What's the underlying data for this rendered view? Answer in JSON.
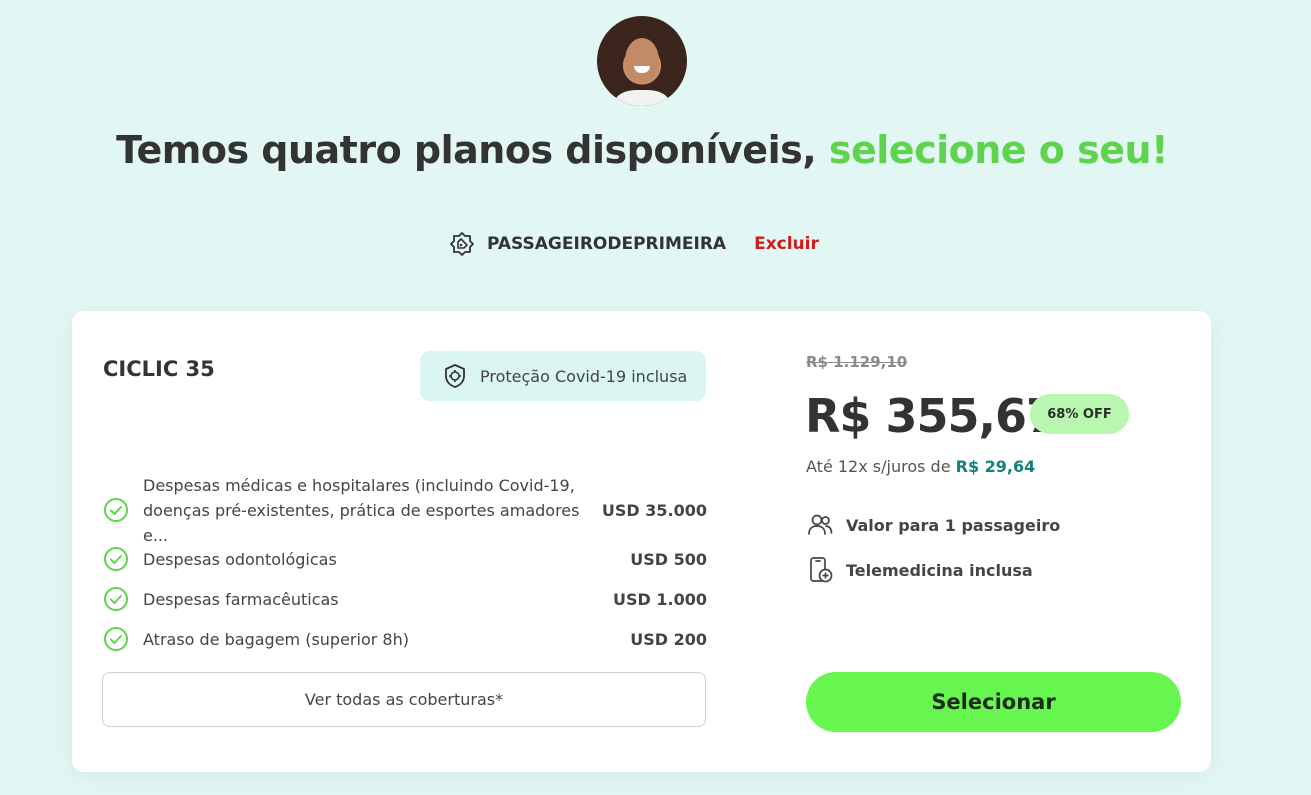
{
  "header": {
    "headline_prefix": "Temos quatro planos disponíveis,",
    "headline_accent": "selecione o seu!"
  },
  "coupon": {
    "icon": "tag-icon",
    "code": "PASSAGEIRODEPRIMEIRA",
    "remove_label": "Excluir"
  },
  "plan": {
    "name": "CICLIC 35",
    "covid_badge": "Proteção Covid-19 inclusa",
    "coverages": [
      {
        "label": "Despesas médicas e hospitalares (incluindo Covid-19, doenças pré-existentes, prática de esportes amadores e...",
        "amount": "USD 35.000"
      },
      {
        "label": "Despesas odontológicas",
        "amount": "USD 500"
      },
      {
        "label": "Despesas farmacêuticas",
        "amount": "USD 1.000"
      },
      {
        "label": "Atraso de bagagem (superior 8h)",
        "amount": "USD 200"
      }
    ],
    "see_all_label": "Ver todas as coberturas*",
    "old_price": "R$ 1.129,10",
    "price": "R$ 355,67",
    "discount": "68% OFF",
    "installments_prefix": "Até 12x s/juros de",
    "installments_value": "R$ 29,64",
    "features": [
      {
        "icon": "users-icon",
        "label": "Valor para 1 passageiro"
      },
      {
        "icon": "phone-medical-icon",
        "label": "Telemedicina inclusa"
      }
    ],
    "select_label": "Selecionar"
  },
  "colors": {
    "accent_green": "#5fd34e",
    "button_green": "#66f64f",
    "remove_red": "#d11a1a",
    "installment_teal": "#11837e",
    "background": "#e2f6f4"
  }
}
